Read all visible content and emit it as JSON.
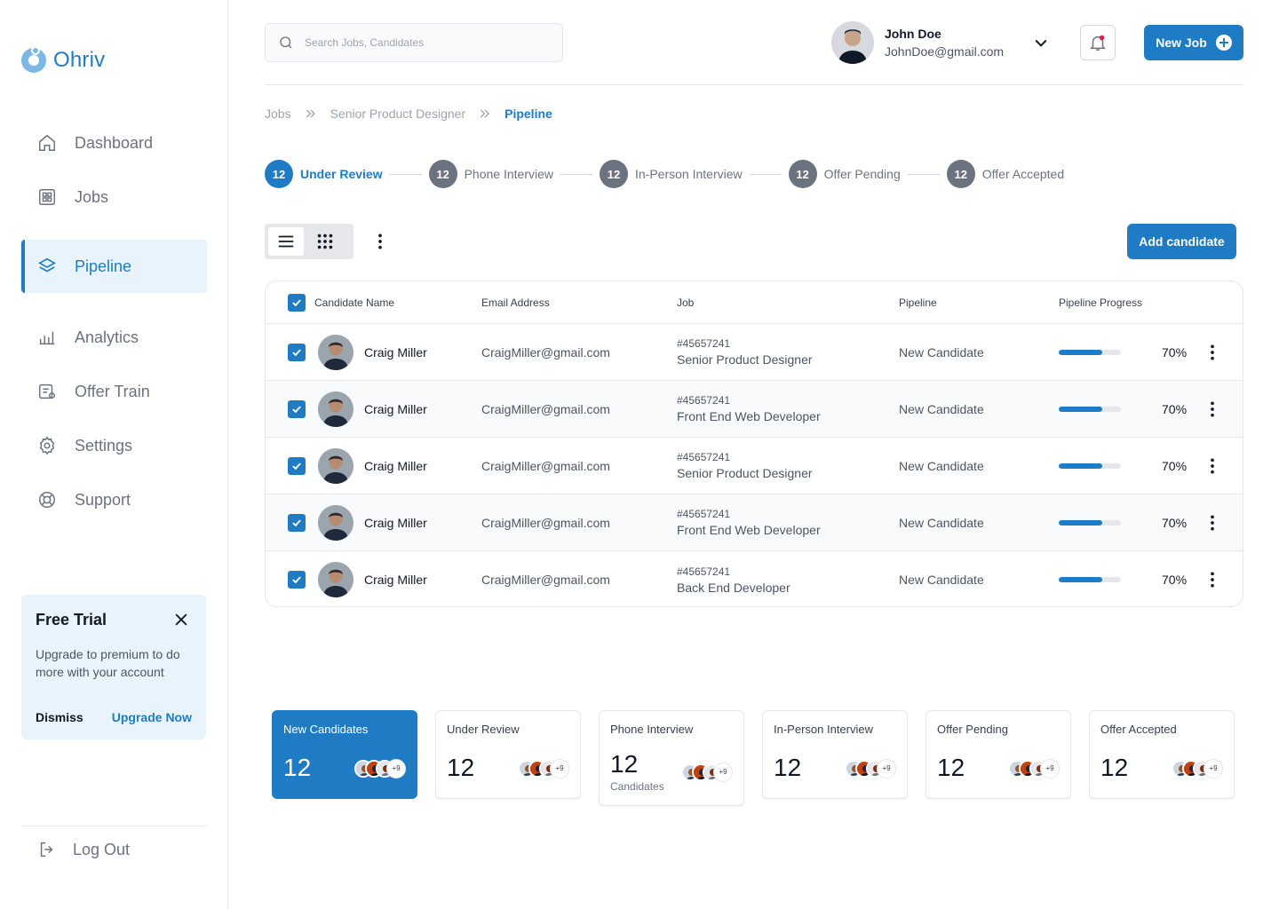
{
  "app": {
    "name": "Ohriv"
  },
  "sidebar": {
    "items": [
      {
        "label": "Dashboard",
        "icon": "home-icon"
      },
      {
        "label": "Jobs",
        "icon": "grid-icon"
      },
      {
        "label": "Pipeline",
        "icon": "layers-icon",
        "active": true
      },
      {
        "label": "Analytics",
        "icon": "bar-chart-icon"
      },
      {
        "label": "Offer Train",
        "icon": "document-icon"
      },
      {
        "label": "Settings",
        "icon": "gear-icon"
      },
      {
        "label": "Support",
        "icon": "lifebuoy-icon"
      }
    ],
    "trial": {
      "title": "Free Trial",
      "text": "Upgrade to premium to do more with your account",
      "dismiss": "Dismiss",
      "upgrade": "Upgrade Now"
    },
    "logout": "Log Out"
  },
  "header": {
    "search_placeholder": "Search Jobs, Candidates",
    "user": {
      "name": "John Doe",
      "email": "JohnDoe@gmail.com"
    },
    "new_job": "New Job"
  },
  "breadcrumb": [
    "Jobs",
    "Senior Product Designer",
    "Pipeline"
  ],
  "stages": [
    {
      "count": "12",
      "label": "Under Review",
      "active": true
    },
    {
      "count": "12",
      "label": "Phone Interview"
    },
    {
      "count": "12",
      "label": "In-Person Interview"
    },
    {
      "count": "12",
      "label": "Offer Pending"
    },
    {
      "count": "12",
      "label": "Offer Accepted"
    }
  ],
  "toolbar": {
    "add_candidate": "Add candidate"
  },
  "table": {
    "headers": {
      "name": "Candidate Name",
      "email": "Email Address",
      "job": "Job",
      "pipeline": "Pipeline",
      "progress": "Pipeline Progress"
    },
    "rows": [
      {
        "name": "Craig Miller",
        "email": "CraigMiller@gmail.com",
        "job_id": "#45657241",
        "job_title": "Senior Product Designer",
        "pipeline": "New Candidate",
        "progress": 70,
        "progress_label": "70%"
      },
      {
        "name": "Craig Miller",
        "email": "CraigMiller@gmail.com",
        "job_id": "#45657241",
        "job_title": "Front End Web Developer",
        "pipeline": "New Candidate",
        "progress": 70,
        "progress_label": "70%"
      },
      {
        "name": "Craig Miller",
        "email": "CraigMiller@gmail.com",
        "job_id": "#45657241",
        "job_title": "Senior Product Designer",
        "pipeline": "New Candidate",
        "progress": 70,
        "progress_label": "70%"
      },
      {
        "name": "Craig Miller",
        "email": "CraigMiller@gmail.com",
        "job_id": "#45657241",
        "job_title": "Front End Web Developer",
        "pipeline": "New Candidate",
        "progress": 70,
        "progress_label": "70%"
      },
      {
        "name": "Craig Miller",
        "email": "CraigMiller@gmail.com",
        "job_id": "#45657241",
        "job_title": "Back End Developer",
        "pipeline": "New Candidate",
        "progress": 70,
        "progress_label": "70%"
      }
    ]
  },
  "summary_cards": [
    {
      "title": "New Candidates",
      "count": "12",
      "more": "+9",
      "primary": true
    },
    {
      "title": "Under Review",
      "count": "12",
      "more": "+9"
    },
    {
      "title": "Phone Interview",
      "count": "12",
      "sub": "Candidates",
      "more": "+9"
    },
    {
      "title": "In-Person Interview",
      "count": "12",
      "more": "+9"
    },
    {
      "title": "Offer Pending",
      "count": "12",
      "more": "+9"
    },
    {
      "title": "Offer Accepted",
      "count": "12",
      "more": "+9"
    }
  ],
  "colors": {
    "accent": "#1f7cc4",
    "accent_light": "#e8f3fb",
    "muted": "#6b7280"
  }
}
